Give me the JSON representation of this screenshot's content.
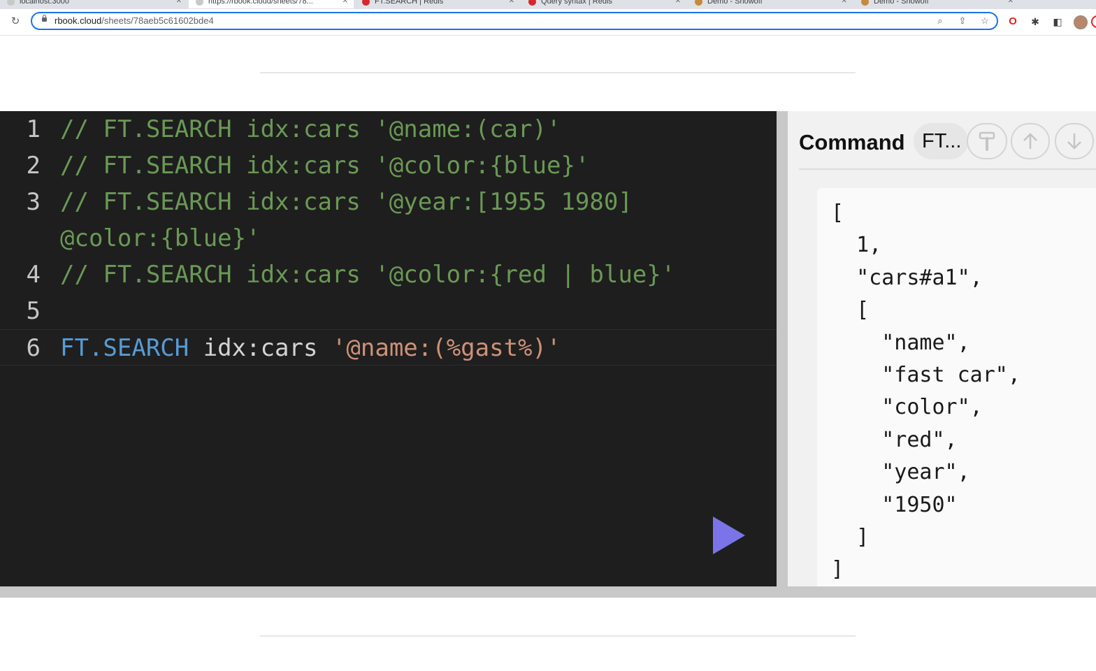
{
  "browser": {
    "tabs": [
      {
        "label": "localhost:3000",
        "favicon": "globe-icon"
      },
      {
        "label": "https://rbook.cloud/sheets/78...",
        "favicon": "page-icon"
      },
      {
        "label": "FT.SEARCH | Redis",
        "favicon": "redis-icon"
      },
      {
        "label": "Query syntax | Redis",
        "favicon": "redis-icon"
      },
      {
        "label": "Demo - Showoff",
        "favicon": "demo-icon"
      },
      {
        "label": "Demo - Showoff",
        "favicon": "demo-icon"
      }
    ],
    "url_host": "rbook.cloud",
    "url_path": "/sheets/78aeb5c61602bde4",
    "toolbar_icons": [
      "zoom-icon",
      "share-icon",
      "bookmark-star-icon",
      "opera-icon",
      "extensions-icon",
      "sidebar-icon",
      "profile-icon"
    ]
  },
  "editor": {
    "lines": [
      {
        "number": "1",
        "tokens": [
          {
            "t": "comment",
            "v": "// FT.SEARCH idx:cars '@name:(car)'"
          }
        ]
      },
      {
        "number": "2",
        "tokens": [
          {
            "t": "comment",
            "v": "// FT.SEARCH idx:cars '@color:{blue}'"
          }
        ]
      },
      {
        "number": "3",
        "tokens": [
          {
            "t": "comment",
            "v": "// FT.SEARCH idx:cars '@year:[1955 1980]"
          }
        ]
      },
      {
        "number": "",
        "tokens": [
          {
            "t": "comment",
            "v": "@color:{blue}'"
          }
        ]
      },
      {
        "number": "4",
        "tokens": [
          {
            "t": "comment",
            "v": "// FT.SEARCH idx:cars '@color:{red | blue}'"
          }
        ]
      },
      {
        "number": "5",
        "tokens": []
      },
      {
        "number": "6",
        "current": true,
        "tokens": [
          {
            "t": "kw",
            "v": "FT.SEARCH"
          },
          {
            "t": "plain",
            "v": " idx:cars "
          },
          {
            "t": "str",
            "v": "'@name:(%gast%)'"
          }
        ]
      }
    ],
    "run_button_icon": "play-icon",
    "run_button_color": "#7b74e8"
  },
  "panel": {
    "title": "Command",
    "command_button_label": "FT...",
    "icons": [
      "format-paint-icon",
      "arrow-up-icon",
      "arrow-down-icon"
    ],
    "output_lines": [
      "[",
      "  1,",
      "  \"cars#a1\",",
      "  [",
      "    \"name\",",
      "    \"fast car\",",
      "    \"color\",",
      "    \"red\",",
      "    \"year\",",
      "    \"1950\"",
      "  ]",
      "]"
    ]
  },
  "colors": {
    "comment": "#6a9955",
    "keyword": "#569cd6",
    "string": "#ce9178",
    "editor_bg": "#1e1e1e",
    "accent": "#7b74e8"
  }
}
